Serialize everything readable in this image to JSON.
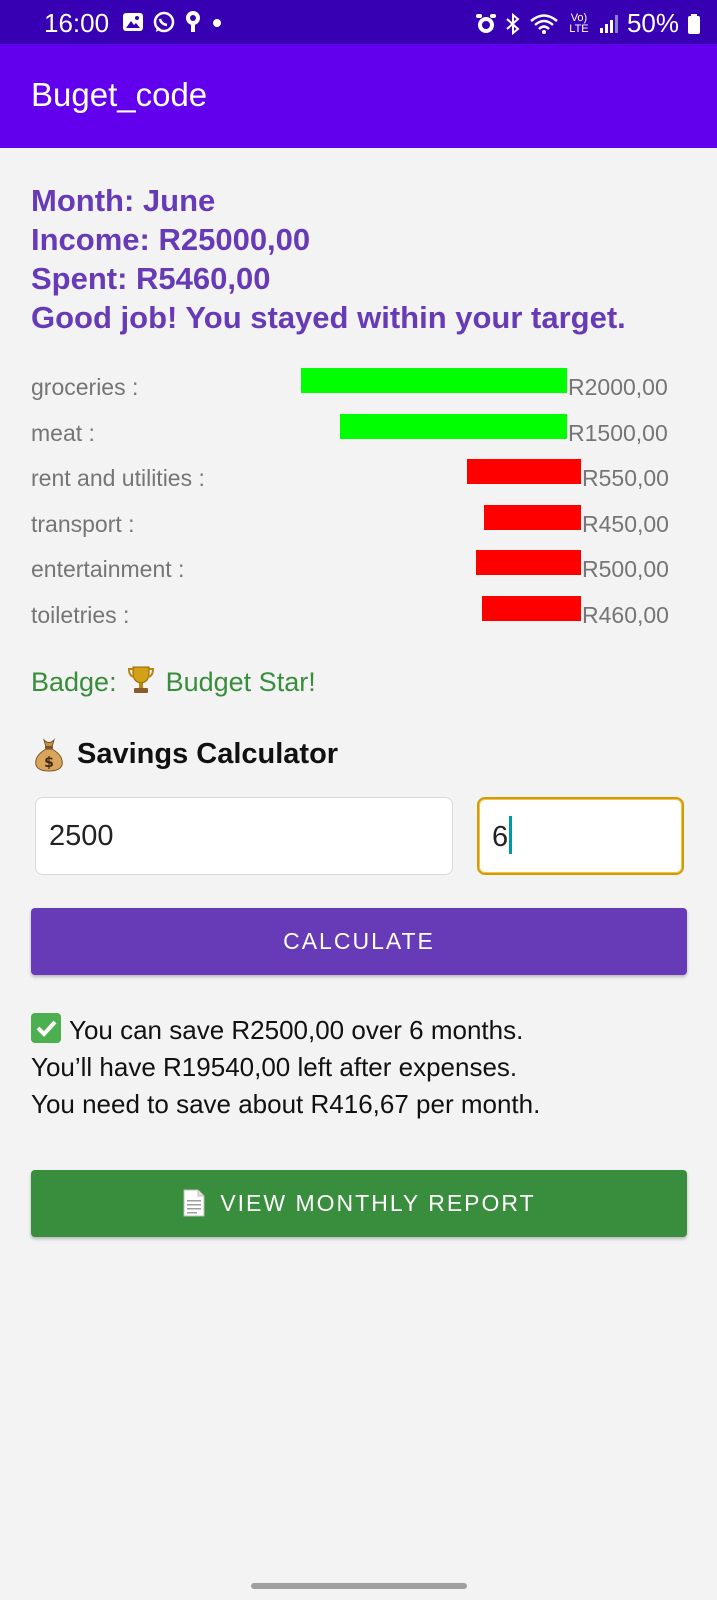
{
  "status_bar": {
    "time": "16:00",
    "battery": "50%",
    "left_icons": [
      "gallery-icon",
      "whatsapp-icon",
      "location-icon",
      "dot-icon"
    ],
    "right_icons": [
      "alarm-icon",
      "bluetooth-icon",
      "wifi-icon",
      "volte-icon",
      "signal-icon",
      "battery-icon"
    ],
    "volte_label": "Vo) LTE"
  },
  "app_bar": {
    "title": "Buget_code",
    "color": "#6200ee"
  },
  "summary": {
    "month": "Month: June",
    "income": "Income: R25000,00",
    "spent": "Spent: R5460,00",
    "message": "Good job! You stayed within your target.",
    "color": "#673ab7"
  },
  "categories": [
    {
      "label": "groceries :",
      "amount": "R2000,00",
      "status": "over",
      "color": "#00ff00"
    },
    {
      "label": "meat :",
      "amount": "R1500,00",
      "status": "over",
      "color": "#00ff00"
    },
    {
      "label": "rent and utilities :",
      "amount": "R550,00",
      "status": "under",
      "color": "#ff0000"
    },
    {
      "label": "transport :",
      "amount": "R450,00",
      "status": "under",
      "color": "#ff0000"
    },
    {
      "label": "entertainment :",
      "amount": "R500,00",
      "status": "under",
      "color": "#ff0000"
    },
    {
      "label": "toiletries :",
      "amount": "R460,00",
      "status": "under",
      "color": "#ff0000"
    }
  ],
  "badge": {
    "prefix": "Badge:",
    "text": "Budget Star!",
    "icon": "trophy-icon"
  },
  "savings": {
    "title": "Savings Calculator",
    "icon": "money-bag-icon",
    "amount_value": "2500",
    "months_value": "6",
    "calculate_label": "CALCULATE",
    "calculate_color": "#673ab7"
  },
  "result": {
    "line1": "You can save R2500,00 over 6 months.",
    "line2": "You’ll have R19540,00 left after expenses.",
    "line3": "You need to save about R416,67 per month."
  },
  "report": {
    "label": "VIEW MONTHLY REPORT",
    "icon": "document-icon",
    "color": "#388e3c"
  }
}
